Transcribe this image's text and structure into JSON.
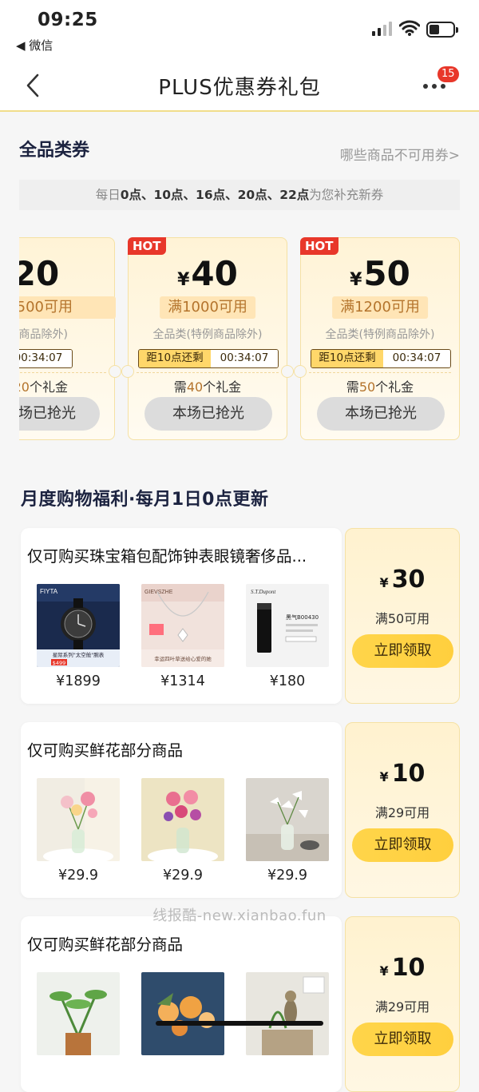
{
  "status": {
    "time": "09:25",
    "back_app": "◀ 微信"
  },
  "nav": {
    "title": "PLUS优惠券礼包",
    "badge": "15"
  },
  "section1": {
    "title": "全品类券",
    "not_usable_link": "哪些商品不可用券>",
    "refill_pre": "每日",
    "refill_times": "0点、10点、16点、20点、22点",
    "refill_post": "为您补充新券"
  },
  "coupons": [
    {
      "hot": "",
      "currency": "",
      "amount": "20",
      "cond": "500可用",
      "scope": "特例商品除外)",
      "timer_label": "剩",
      "countdown": "00:34:07",
      "need_pre": "",
      "need_val": "20",
      "need_post": "个礼金",
      "status": "场已抢光"
    },
    {
      "hot": "HOT",
      "currency": "¥",
      "amount": "40",
      "cond": "满1000可用",
      "scope": "全品类(特例商品除外)",
      "timer_label": "距10点还剩",
      "countdown": "00:34:07",
      "need_pre": "需",
      "need_val": "40",
      "need_post": "个礼金",
      "status": "本场已抢光"
    },
    {
      "hot": "HOT",
      "currency": "¥",
      "amount": "50",
      "cond": "满1200可用",
      "scope": "全品类(特例商品除外)",
      "timer_label": "距10点还剩",
      "countdown": "00:34:07",
      "need_pre": "需",
      "need_val": "50",
      "need_post": "个礼金",
      "status": "本场已抢光"
    }
  ],
  "monthly": {
    "title": "月度购物福利·每月1日0点更新",
    "offers": [
      {
        "title": "仅可购买珠宝箱包配饰钟表眼镜奢侈品...",
        "currency": "¥",
        "amount": "30",
        "cond": "满50可用",
        "claim": "立即领取",
        "products": [
          {
            "price": "¥1899"
          },
          {
            "price": "¥1314"
          },
          {
            "price": "¥180"
          }
        ]
      },
      {
        "title": "仅可购买鲜花部分商品",
        "currency": "¥",
        "amount": "10",
        "cond": "满29可用",
        "claim": "立即领取",
        "products": [
          {
            "price": "¥29.9"
          },
          {
            "price": "¥29.9"
          },
          {
            "price": "¥29.9"
          }
        ]
      },
      {
        "title": "仅可购买鲜花部分商品",
        "currency": "¥",
        "amount": "10",
        "cond": "满29可用",
        "claim": "立即领取",
        "products": [
          {
            "price": ""
          },
          {
            "price": ""
          },
          {
            "price": ""
          }
        ]
      }
    ]
  },
  "product_images": {
    "p0_0": {
      "brand": "FIYTA",
      "caption": "星际系列\"太空舱\"腕表",
      "price_tag": "$499"
    },
    "p0_1": {
      "brand": "GIEVSZHE",
      "caption": "幸运四叶草送给心爱的她"
    },
    "p0_2": {
      "brand": "S.T.Dupont",
      "name": "黑气B00430"
    }
  },
  "watermark": "线报酷-new.xianbao.fun"
}
